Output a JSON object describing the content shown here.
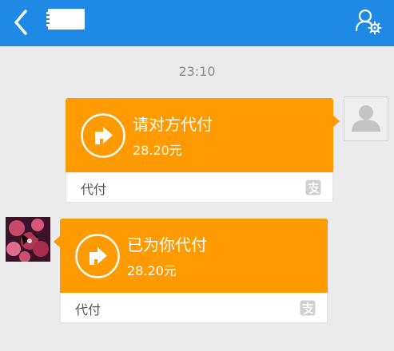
{
  "header": {
    "title": "",
    "back_icon": "chevron-left-icon",
    "profile_icon": "user-settings-icon",
    "bg_color": "#1e8ae6"
  },
  "chat": {
    "timestamp": "23:10",
    "messages": [
      {
        "side": "right",
        "title": "请对方代付",
        "amount": "28.20元",
        "footer_label": "代付",
        "icon": "share-arrow-icon",
        "footer_icon": "alipay-icon"
      },
      {
        "side": "left",
        "title": "已为你代付",
        "amount": "28.20元",
        "footer_label": "代付",
        "icon": "share-arrow-icon",
        "footer_icon": "alipay-icon"
      }
    ]
  },
  "colors": {
    "card_orange": "#ff9b00",
    "background": "#ebebeb"
  }
}
